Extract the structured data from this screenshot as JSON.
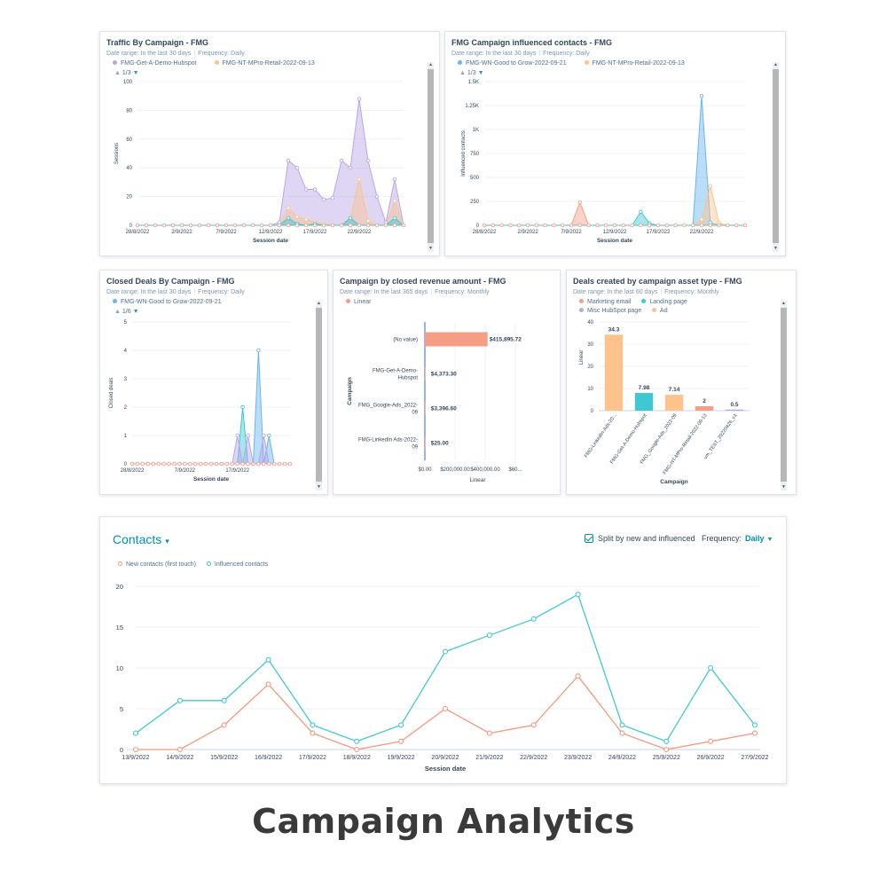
{
  "footer_title": "Campaign Analytics",
  "meta_sep": "|",
  "pager_up": "▲",
  "pager_down": "▼",
  "colors": {
    "purple": "#b9a5e6",
    "orange": "#fdc38b",
    "salmon": "#f59e86",
    "teal": "#3fc7d3",
    "blue": "#69b6ef",
    "contacts_new": "#f6977c",
    "contacts_inf": "#41c8d2",
    "accent": "#0091ae"
  },
  "charts": {
    "traffic": {
      "title": "Traffic By Campaign - FMG",
      "date_range": "Date range: In the last 30 days",
      "frequency": "Frequency: Daily",
      "legend": [
        "FMG-Get-A-Demo-Hubspot",
        "FMG-NT-MPro-Retail-2022-09-13"
      ],
      "pager": "1/3",
      "ylabel": "Sessions",
      "xlabel": "Session date",
      "yticks": [
        "0",
        "20",
        "40",
        "60",
        "80",
        "100"
      ],
      "xticks": [
        "28/8/2022",
        "2/9/2022",
        "7/9/2022",
        "12/9/2022",
        "17/9/2022",
        "22/9/2022"
      ]
    },
    "influenced": {
      "title": "FMG Campaign influenced contacts - FMG",
      "date_range": "Date range: In the last 30 days",
      "frequency": "Frequency: Daily",
      "legend": [
        "FMG-WN-Good to Grow-2022-09-21",
        "FMG-NT-MPro-Retail-2022-09-13"
      ],
      "pager": "1/3",
      "ylabel": "Influenced contacts",
      "xlabel": "Session date",
      "yticks": [
        "0",
        "250",
        "500",
        "750",
        "1K",
        "1.25K",
        "1.5K"
      ],
      "xticks": [
        "28/8/2022",
        "2/9/2022",
        "7/9/2022",
        "12/9/2022",
        "17/9/2022",
        "22/9/2022"
      ]
    },
    "closed_deals": {
      "title": "Closed Deals By Campaign - FMG",
      "date_range": "Date range: In the last 30 days",
      "frequency": "Frequency: Daily",
      "legend": [
        "FMG-WN-Good to Grow-2022-09-21"
      ],
      "pager": "1/6",
      "ylabel": "Closed deals",
      "xlabel": "Session date",
      "yticks": [
        "0",
        "1",
        "2",
        "3",
        "4",
        "5"
      ],
      "xticks": [
        "28/8/2022",
        "7/9/2022",
        "17/9/2022"
      ]
    },
    "revenue": {
      "title": "Campaign by closed revenue amount - FMG",
      "date_range": "Date range: In the last 365 days",
      "frequency": "Frequency: Monthly",
      "legend": [
        "Linear"
      ],
      "ylabel": "Campaign",
      "xlabel": "Linear",
      "categories": [
        [
          "(No value)"
        ],
        [
          "FMG-Get-A-Demo-",
          "Hubspot"
        ],
        [
          "FMG_Google-Ads_2022-",
          "09"
        ],
        [
          "FMG-LinkedIn Ads-2022-",
          "09"
        ]
      ],
      "value_labels": [
        "$415,895.72",
        "$4,373.30",
        "$3,396.60",
        "$25.00"
      ],
      "xticks": [
        "$0.00",
        "$200,000.00",
        "$400,000.00",
        "$60..."
      ]
    },
    "deals_created": {
      "title": "Deals created by campaign asset type - FMG",
      "date_range": "Date range: In the last 60 days",
      "frequency": "Frequency: Monthly",
      "legend": [
        "Marketing email",
        "Landing page",
        "Misc HubSpot page",
        "Ad"
      ],
      "ylabel": "Linear",
      "xlabel": "Campaign",
      "yticks": [
        "0",
        "10",
        "20",
        "30",
        "40"
      ],
      "categories": [
        "FMG-LinkedIn-Ads-20...",
        "FMG-Get-A-Demo-Hubspot",
        "FMG_Google-Ads_2022-09",
        "FMG-NT-MPro-Retail-2022-09-13",
        "vm_TEST_20220426_v1"
      ],
      "value_labels": [
        "34.3",
        "7.98",
        "7.14",
        "2",
        "0.5"
      ]
    },
    "contacts": {
      "title": "Contacts",
      "caret": "▾",
      "split_label": "Split by new and influenced",
      "frequency_label": "Frequency:",
      "frequency_value": "Daily",
      "legend": [
        "New contacts (first touch)",
        "Influenced contacts"
      ],
      "xlabel": "Session date",
      "yticks": [
        "0",
        "5",
        "10",
        "15",
        "20"
      ],
      "xticks": [
        "13/9/2022",
        "14/9/2022",
        "15/9/2022",
        "16/9/2022",
        "17/9/2022",
        "18/9/2022",
        "19/9/2022",
        "20/9/2022",
        "21/9/2022",
        "22/9/2022",
        "23/9/2022",
        "24/9/2022",
        "25/9/2022",
        "26/9/2022",
        "27/9/2022"
      ]
    }
  },
  "chart_data": [
    {
      "type": "area",
      "title": "Traffic By Campaign - FMG",
      "xlabel": "Session date",
      "ylabel": "Sessions",
      "ylim": [
        0,
        100
      ],
      "x": [
        "28/8",
        "29/8",
        "30/8",
        "31/8",
        "1/9",
        "2/9",
        "3/9",
        "4/9",
        "5/9",
        "6/9",
        "7/9",
        "8/9",
        "9/9",
        "10/9",
        "11/9",
        "12/9",
        "13/9",
        "14/9",
        "15/9",
        "16/9",
        "17/9",
        "18/9",
        "19/9",
        "20/9",
        "21/9",
        "22/9",
        "23/9",
        "24/9",
        "25/9",
        "26/9",
        "27/9"
      ],
      "series": [
        {
          "name": "FMG-Get-A-Demo-Hubspot",
          "values": [
            0,
            0,
            0,
            0,
            0,
            0,
            0,
            0,
            0,
            0,
            0,
            0,
            0,
            0,
            0,
            0,
            2,
            45,
            40,
            25,
            25,
            18,
            19,
            45,
            40,
            88,
            45,
            20,
            2,
            32,
            0
          ]
        },
        {
          "name": "FMG-NT-MPro-Retail-2022-09-13",
          "values": [
            0,
            0,
            0,
            0,
            0,
            0,
            0,
            0,
            0,
            0,
            0,
            0,
            0,
            0,
            0,
            0,
            0,
            12,
            6,
            4,
            2,
            1,
            0,
            0,
            5,
            32,
            3,
            0,
            0,
            17,
            0
          ]
        },
        {
          "values": [
            0,
            0,
            0,
            0,
            0,
            0,
            0,
            0,
            0,
            0,
            0,
            0,
            0,
            0,
            0,
            0,
            0,
            5,
            1,
            0,
            1,
            0,
            0,
            0,
            5,
            0,
            0,
            0,
            0,
            5,
            0
          ]
        }
      ]
    },
    {
      "type": "area",
      "title": "FMG Campaign influenced contacts - FMG",
      "xlabel": "Session date",
      "ylabel": "Influenced contacts",
      "ylim": [
        0,
        1500
      ],
      "x": [
        "28/8",
        "29/8",
        "30/8",
        "31/8",
        "1/9",
        "2/9",
        "3/9",
        "4/9",
        "5/9",
        "6/9",
        "7/9",
        "8/9",
        "9/9",
        "10/9",
        "11/9",
        "12/9",
        "13/9",
        "14/9",
        "15/9",
        "16/9",
        "17/9",
        "18/9",
        "19/9",
        "20/9",
        "21/9",
        "22/9",
        "23/9",
        "24/9",
        "25/9",
        "26/9",
        "27/9"
      ],
      "series": [
        {
          "name": "FMG-WN-Good to Grow-2022-09-21",
          "values": [
            0,
            0,
            0,
            0,
            0,
            0,
            0,
            0,
            0,
            0,
            0,
            0,
            0,
            0,
            0,
            0,
            0,
            0,
            0,
            0,
            0,
            0,
            0,
            0,
            0,
            1350,
            30,
            0,
            0,
            0,
            0
          ]
        },
        {
          "name": "FMG-NT-MPro-Retail-2022-09-13",
          "values": [
            0,
            0,
            0,
            0,
            0,
            0,
            0,
            0,
            0,
            0,
            0,
            0,
            0,
            0,
            0,
            0,
            0,
            0,
            0,
            0,
            0,
            0,
            0,
            0,
            0,
            60,
            410,
            25,
            0,
            0,
            0
          ]
        },
        {
          "values": [
            0,
            0,
            0,
            0,
            0,
            0,
            0,
            0,
            0,
            0,
            0,
            240,
            0,
            0,
            0,
            0,
            0,
            0,
            0,
            0,
            0,
            0,
            0,
            0,
            0,
            0,
            0,
            0,
            0,
            0,
            0
          ]
        },
        {
          "values": [
            0,
            0,
            0,
            0,
            0,
            0,
            0,
            0,
            0,
            0,
            0,
            0,
            0,
            0,
            0,
            0,
            0,
            0,
            140,
            20,
            0,
            0,
            0,
            0,
            0,
            0,
            0,
            0,
            0,
            0,
            0
          ]
        }
      ]
    },
    {
      "type": "area",
      "title": "Closed Deals By Campaign - FMG",
      "xlabel": "Session date",
      "ylabel": "Closed deals",
      "ylim": [
        0,
        5
      ],
      "x": [
        "28/8",
        "29/8",
        "30/8",
        "31/8",
        "1/9",
        "2/9",
        "3/9",
        "4/9",
        "5/9",
        "6/9",
        "7/9",
        "8/9",
        "9/9",
        "10/9",
        "11/9",
        "12/9",
        "13/9",
        "14/9",
        "15/9",
        "16/9",
        "17/9",
        "18/9",
        "19/9",
        "20/9",
        "21/9",
        "22/9",
        "23/9",
        "24/9",
        "25/9",
        "26/9",
        "27/9"
      ],
      "series": [
        {
          "name": "FMG-WN-Good to Grow-2022-09-21",
          "values": [
            0,
            0,
            0,
            0,
            0,
            0,
            0,
            0,
            0,
            0,
            0,
            0,
            0,
            0,
            0,
            0,
            0,
            0,
            0,
            0,
            0,
            0,
            0,
            0,
            4,
            0,
            1,
            0,
            0,
            0,
            0
          ]
        },
        {
          "values": [
            0,
            0,
            0,
            0,
            0,
            0,
            0,
            0,
            0,
            0,
            0,
            0,
            0,
            0,
            0,
            0,
            0,
            0,
            0,
            0,
            0,
            2,
            0,
            0,
            0,
            0,
            0,
            0,
            0,
            0,
            0
          ]
        },
        {
          "values": [
            0,
            0,
            0,
            0,
            0,
            0,
            0,
            0,
            0,
            0,
            0,
            0,
            0,
            0,
            0,
            0,
            0,
            0,
            0,
            0,
            1,
            0,
            1,
            0,
            0,
            1,
            0,
            0,
            0,
            0,
            0
          ]
        }
      ]
    },
    {
      "type": "bar",
      "title": "Campaign by closed revenue amount - FMG",
      "xlabel": "Linear",
      "ylabel": "Campaign",
      "categories": [
        "(No value)",
        "FMG-Get-A-Demo-Hubspot",
        "FMG_Google-Ads_2022-09",
        "FMG-LinkedIn Ads-2022-09"
      ],
      "series": [
        {
          "name": "Linear",
          "values": [
            415895.72,
            4373.3,
            3396.6,
            25.0
          ]
        }
      ],
      "xlim": [
        0,
        700000
      ]
    },
    {
      "type": "bar",
      "title": "Deals created by campaign asset type - FMG",
      "xlabel": "Campaign",
      "ylabel": "Linear",
      "ylim": [
        0,
        40
      ],
      "categories": [
        "FMG-LinkedIn-Ads-20...",
        "FMG-Get-A-Demo-Hubspot",
        "FMG_Google-Ads_2022-09",
        "FMG-NT-MPro-Retail-2022-09-13",
        "vm_TEST_20220426_v1"
      ],
      "series": [
        {
          "name": "Ad",
          "values": [
            34.3,
            0,
            7.14,
            0,
            0
          ]
        },
        {
          "name": "Landing page",
          "values": [
            0,
            7.98,
            0,
            0,
            0
          ]
        },
        {
          "name": "Marketing email",
          "values": [
            0,
            0,
            0,
            2,
            0
          ]
        },
        {
          "name": "Misc HubSpot page",
          "values": [
            0,
            0,
            0,
            0,
            0.5
          ]
        }
      ]
    },
    {
      "type": "line",
      "title": "Contacts",
      "xlabel": "Session date",
      "ylim": [
        0,
        20
      ],
      "x": [
        "13/9/2022",
        "14/9/2022",
        "15/9/2022",
        "16/9/2022",
        "17/9/2022",
        "18/9/2022",
        "19/9/2022",
        "20/9/2022",
        "21/9/2022",
        "22/9/2022",
        "23/9/2022",
        "24/9/2022",
        "25/9/2022",
        "26/9/2022",
        "27/9/2022"
      ],
      "series": [
        {
          "name": "New contacts (first touch)",
          "values": [
            0,
            0,
            3,
            8,
            2,
            0,
            1,
            5,
            2,
            3,
            9,
            2,
            0,
            1,
            2
          ]
        },
        {
          "name": "Influenced contacts",
          "values": [
            2,
            6,
            6,
            11,
            3,
            1,
            3,
            12,
            14,
            16,
            19,
            3,
            1,
            10,
            3
          ]
        }
      ]
    }
  ]
}
